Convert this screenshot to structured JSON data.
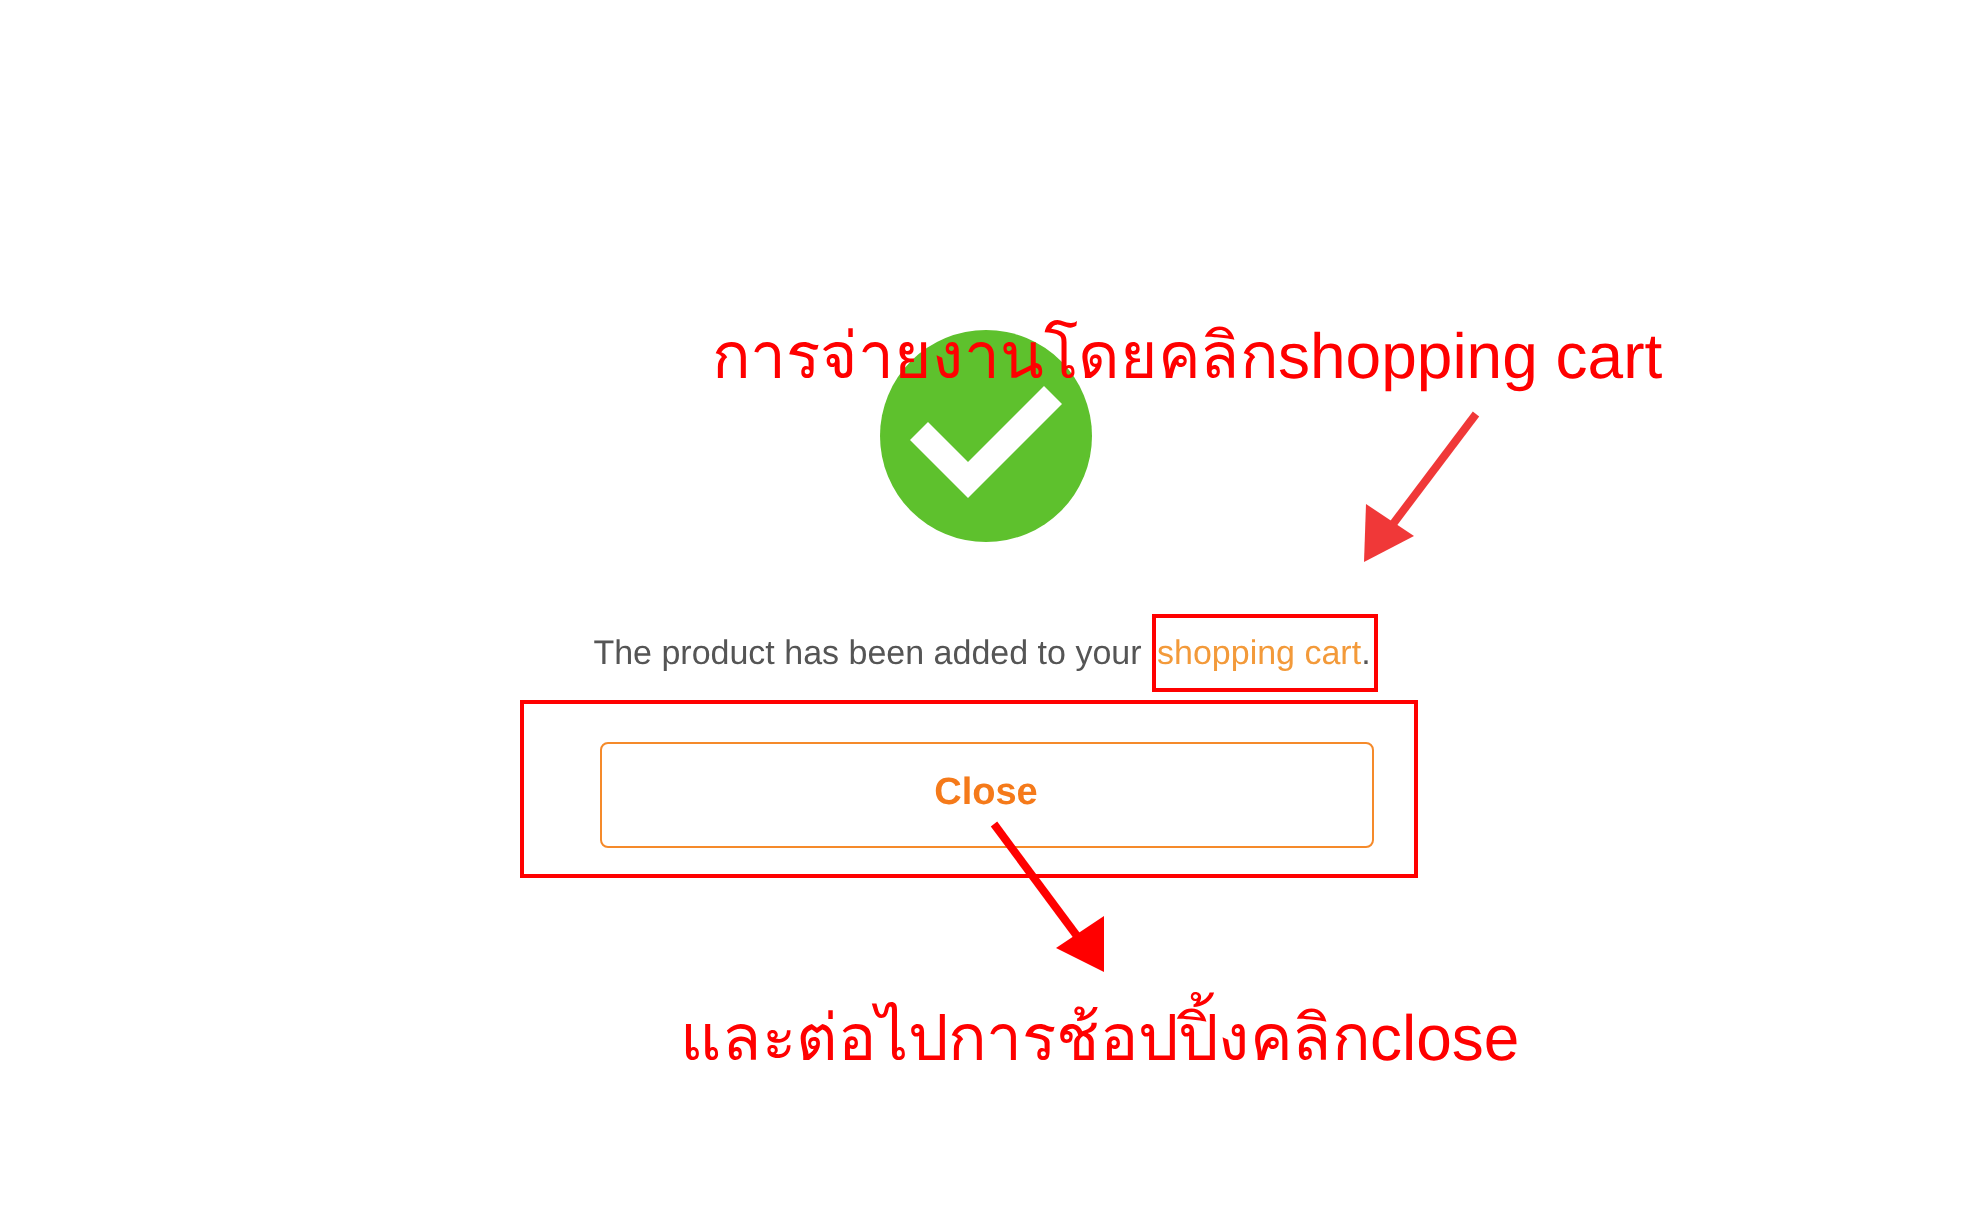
{
  "dialog": {
    "message": "The product has been added to your ",
    "link": "shopping cart",
    "end": ".",
    "button": "Close"
  },
  "annotations": [
    {
      "text": "การจ่ายงานโดยคลิกshopping cart"
    },
    {
      "text": "และต่อไปการช้อปปิ้งคลิกclose"
    }
  ]
}
